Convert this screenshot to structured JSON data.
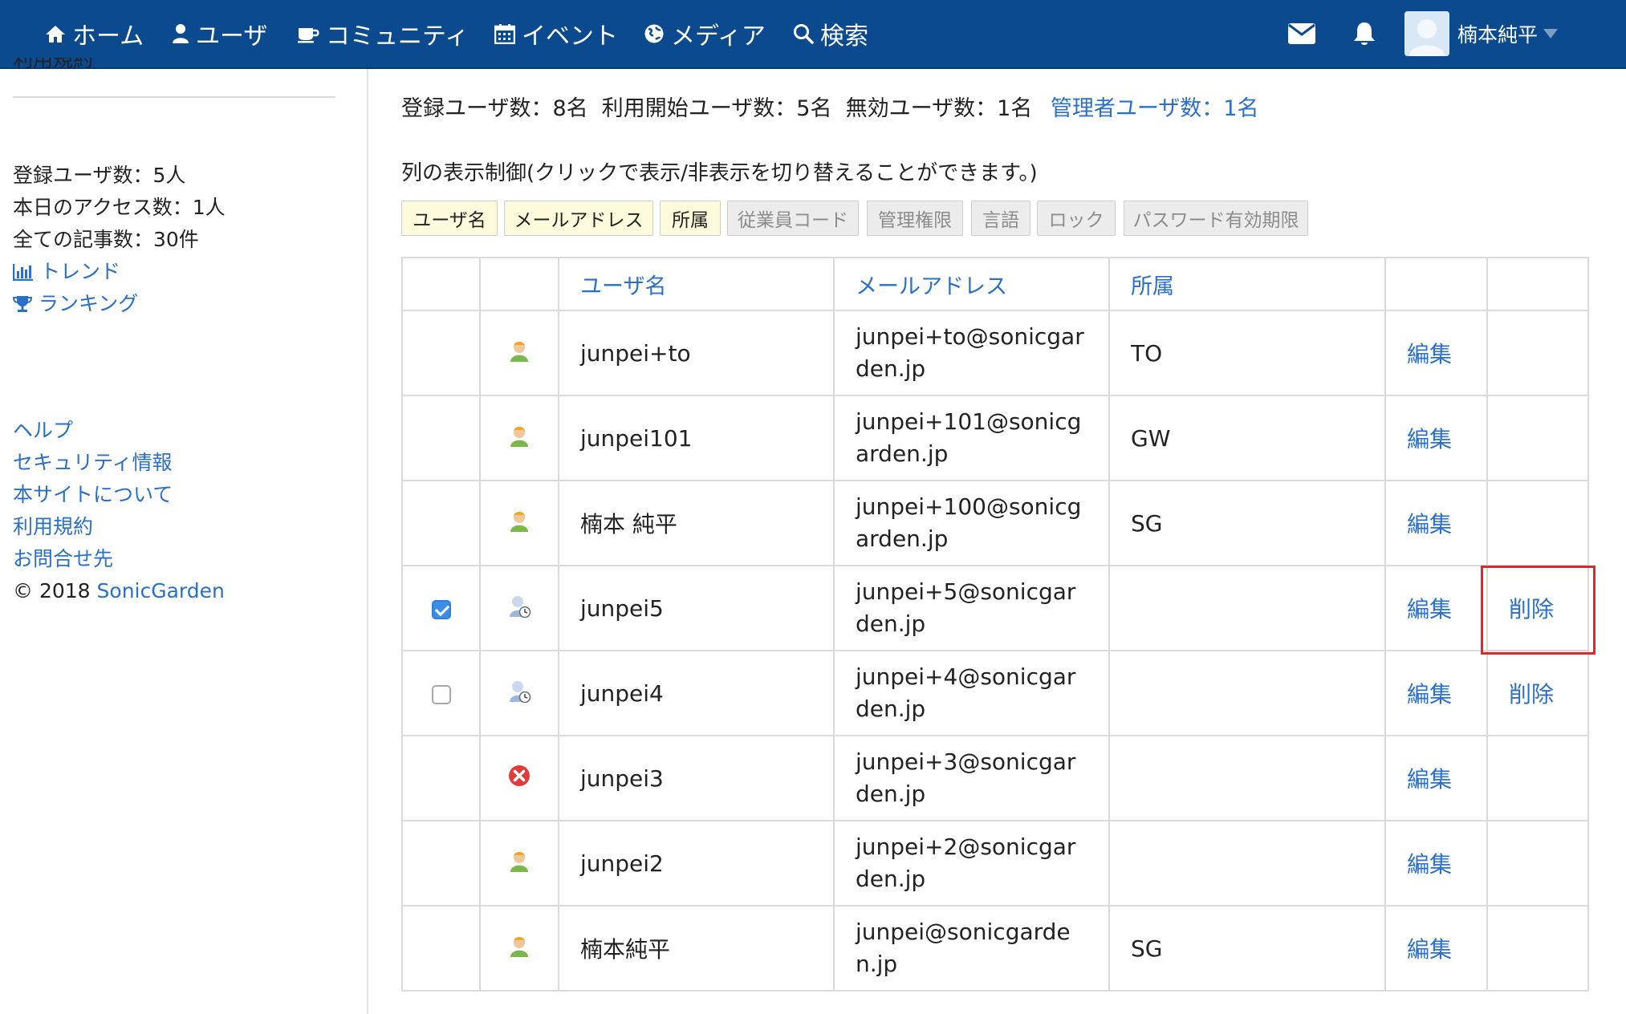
{
  "nav": {
    "home": "ホーム",
    "users": "ユーザ",
    "community": "コミュニティ",
    "events": "イベント",
    "media": "メディア",
    "search": "検索",
    "user_name": "楠本純平"
  },
  "sidebar": {
    "top_link_cut": "利用規約",
    "stats": {
      "registered_users": "登録ユーザ数：5人",
      "today_access": "本日のアクセス数：1人",
      "articles": "全ての記事数：30件"
    },
    "trend": "トレンド",
    "ranking": "ランキング",
    "links": [
      "ヘルプ",
      "セキュリティ情報",
      "本サイトについて",
      "利用規約",
      "お問合せ先"
    ],
    "copyright_prefix": "© 2018",
    "copyright_company": "SonicGarden"
  },
  "summary": {
    "counts": "登録ユーザ数：8名  利用開始ユーザ数：5名  無効ユーザ数：1名",
    "admin_link": "管理者ユーザ数：1名"
  },
  "column_control": {
    "label": "列の表示制御(クリックで表示/非表示を切り替えることができます。)",
    "toggles": [
      {
        "label": "ユーザ名",
        "on": true
      },
      {
        "label": "メールアドレス",
        "on": true
      },
      {
        "label": "所属",
        "on": true
      },
      {
        "label": "従業員コード",
        "on": false
      },
      {
        "label": "管理権限",
        "on": false
      },
      {
        "label": "言語",
        "on": false
      },
      {
        "label": "ロック",
        "on": false
      },
      {
        "label": "パスワード有効期限",
        "on": false
      }
    ]
  },
  "table": {
    "headers": {
      "username": "ユーザ名",
      "email": "メールアドレス",
      "department": "所属"
    },
    "edit_label": "編集",
    "delete_label": "削除",
    "rows": [
      {
        "checkbox": "none",
        "status_icon": "active-user-icon",
        "username": "junpei+to",
        "email": "junpei+to@sonicgarden.jp",
        "department": "TO",
        "deletable": false
      },
      {
        "checkbox": "none",
        "status_icon": "active-user-icon",
        "username": "junpei101",
        "email": "junpei+101@sonicgarden.jp",
        "department": "GW",
        "deletable": false
      },
      {
        "checkbox": "none",
        "status_icon": "active-user-icon",
        "username": "楠本 純平",
        "email": "junpei+100@sonicgarden.jp",
        "department": "SG",
        "deletable": false
      },
      {
        "checkbox": "checked",
        "status_icon": "pending-user-icon",
        "username": "junpei5",
        "email": "junpei+5@sonicgarden.jp",
        "department": "",
        "deletable": true
      },
      {
        "checkbox": "unchecked",
        "status_icon": "pending-user-icon",
        "username": "junpei4",
        "email": "junpei+4@sonicgarden.jp",
        "department": "",
        "deletable": true
      },
      {
        "checkbox": "none",
        "status_icon": "disabled-user-icon",
        "username": "junpei3",
        "email": "junpei+3@sonicgarden.jp",
        "department": "",
        "deletable": false
      },
      {
        "checkbox": "none",
        "status_icon": "active-user-icon",
        "username": "junpei2",
        "email": "junpei+2@sonicgarden.jp",
        "department": "",
        "deletable": false
      },
      {
        "checkbox": "none",
        "status_icon": "active-user-icon",
        "username": "楠本純平",
        "email": "junpei@sonicgarden.jp",
        "department": "SG",
        "deletable": false
      }
    ]
  },
  "colors": {
    "navbar": "#0b4a8f",
    "link": "#2a6fc9",
    "highlight": "#e0282a",
    "toggle_on": "#fdfbdc",
    "toggle_off": "#ececec"
  }
}
